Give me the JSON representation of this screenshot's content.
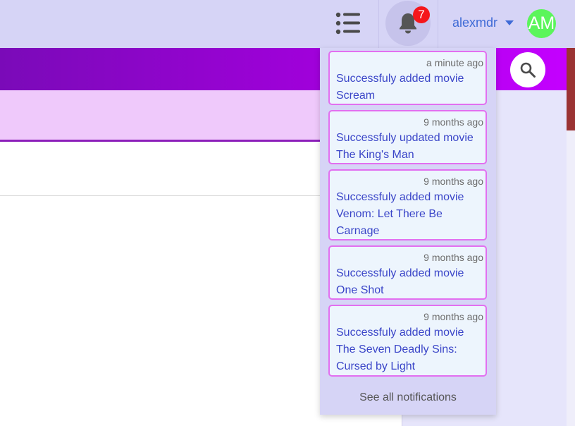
{
  "header": {
    "menu_icon": "list-icon",
    "bell_icon": "bell-icon",
    "notification_count": "7",
    "username": "alexmdr",
    "avatar_initials": "AM",
    "search_icon": "search-icon"
  },
  "notifications": {
    "items": [
      {
        "time": "a minute ago",
        "text": "Successfuly added movie Scream"
      },
      {
        "time": "9 months ago",
        "text": "Successfuly updated movie The King's Man"
      },
      {
        "time": "9 months ago",
        "text": "Successfuly added movie Venom: Let There Be Carnage"
      },
      {
        "time": "9 months ago",
        "text": "Successfuly added movie One Shot"
      },
      {
        "time": "9 months ago",
        "text": "Successfuly added movie The Seven Deadly Sins: Cursed by Light"
      }
    ],
    "see_all_label": "See all notifications"
  },
  "colors": {
    "topbar": "#d6d4f6",
    "banner_start": "#7a0ab8",
    "banner_end": "#c400ff",
    "badge": "#f5161b",
    "avatar": "#5bf55b",
    "notification_border": "#e26ff0",
    "link_text": "#3a45c8"
  }
}
